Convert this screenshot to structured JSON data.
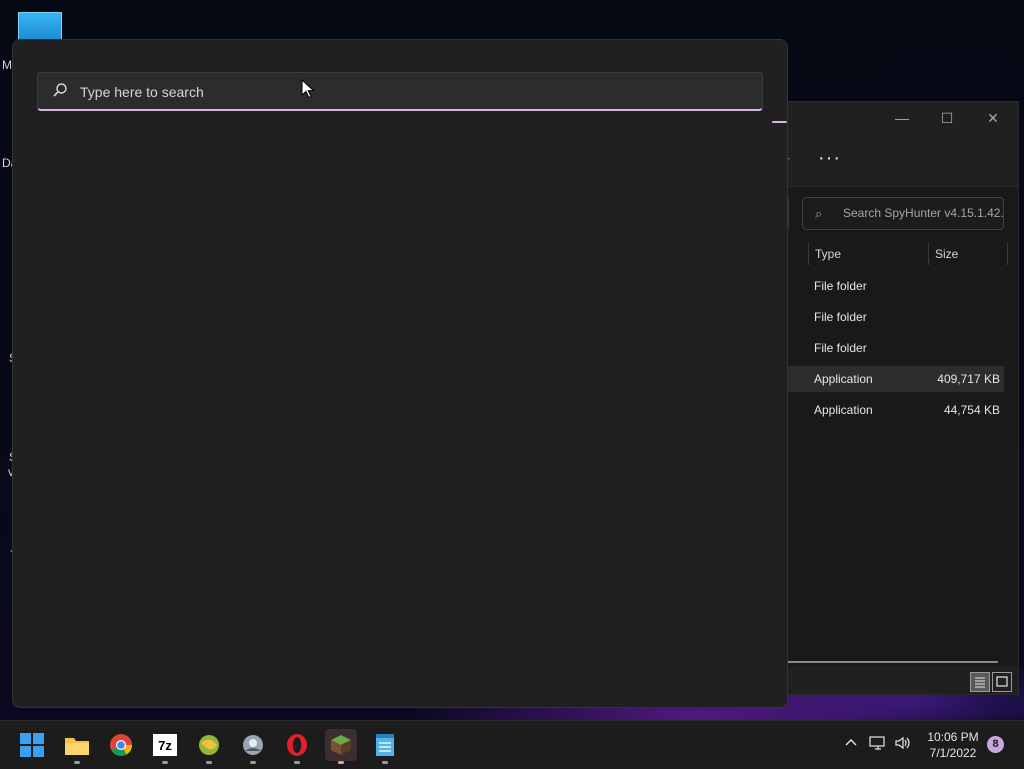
{
  "desktop": {
    "fragments": [
      "M",
      "Da",
      "S",
      "S",
      "v",
      "-"
    ]
  },
  "explorer": {
    "search_placeholder": "Search SpyHunter v4.15.1.42...",
    "columns": [
      "Type",
      "Size"
    ],
    "rows": [
      {
        "type": "File folder",
        "size": ""
      },
      {
        "type": "File folder",
        "size": ""
      },
      {
        "type": "File folder",
        "size": ""
      },
      {
        "type": "Application",
        "size": "409,717 KB"
      },
      {
        "type": "Application",
        "size": "44,754 KB"
      }
    ],
    "more_label": "···",
    "minimize": "—",
    "maximize": "☐",
    "close": "✕"
  },
  "start_menu": {
    "search_placeholder": "Type here to search"
  },
  "taskbar": {
    "apps": [
      "start",
      "file-explorer",
      "chrome",
      "7zip",
      "app-globe",
      "app-circle",
      "opera",
      "minecraft",
      "notepad"
    ],
    "sevenzip_label": "7z",
    "time": "10:06 PM",
    "date": "7/1/2022",
    "notification_count": "8"
  },
  "colors": {
    "accent": "#d8b4e6",
    "taskbar": "#1c1c1c",
    "start_menu": "#202020"
  }
}
